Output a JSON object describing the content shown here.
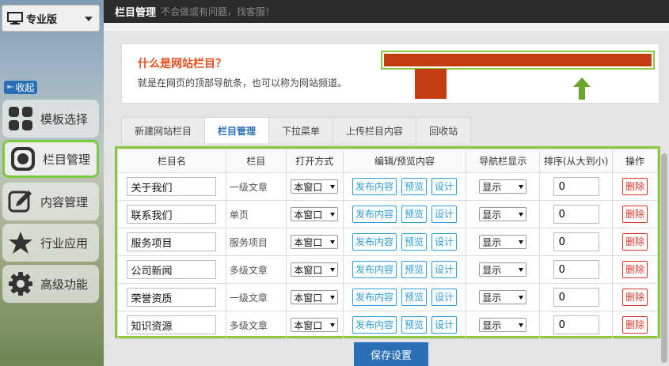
{
  "sidebar": {
    "edition": "专业版",
    "collapse": "收起",
    "items": [
      {
        "label": "模板选择",
        "icon": "grid-icon"
      },
      {
        "label": "栏目管理",
        "icon": "record-icon"
      },
      {
        "label": "内容管理",
        "icon": "pencil-icon"
      },
      {
        "label": "行业应用",
        "icon": "star-icon"
      },
      {
        "label": "高级功能",
        "icon": "gear-icon"
      }
    ],
    "active_index": 1
  },
  "topbar": {
    "title": "栏目管理",
    "subtitle": "不会做或有问题，找客服！"
  },
  "info": {
    "question": "什么是网站栏目？",
    "answer": "就是在网页的顶部导航条，也可以称为网站频道。"
  },
  "tabs": [
    {
      "label": "新建网站栏目"
    },
    {
      "label": "栏目管理"
    },
    {
      "label": "下拉菜单"
    },
    {
      "label": "上传栏目内容"
    },
    {
      "label": "回收站"
    }
  ],
  "active_tab": 1,
  "table": {
    "headers": [
      "栏目名",
      "栏目",
      "打开方式",
      "编辑/预览内容",
      "导航栏显示",
      "排序(从大到小)",
      "操作"
    ],
    "publish_label": "发布内容",
    "preview_label": "预览",
    "design_label": "设计",
    "delete_label": "删除",
    "rows": [
      {
        "name": "关于我们",
        "type": "一级文章",
        "open": "本窗口",
        "show": "显示",
        "order": "0"
      },
      {
        "name": "联系我们",
        "type": "单页",
        "open": "本窗口",
        "show": "显示",
        "order": "0"
      },
      {
        "name": "服务项目",
        "type": "服务项目",
        "open": "本窗口",
        "show": "显示",
        "order": "0"
      },
      {
        "name": "公司新闻",
        "type": "多级文章",
        "open": "本窗口",
        "show": "显示",
        "order": "0"
      },
      {
        "name": "荣誉资质",
        "type": "一级文章",
        "open": "本窗口",
        "show": "显示",
        "order": "0"
      },
      {
        "name": "知识资源",
        "type": "多级文章",
        "open": "本窗口",
        "show": "显示",
        "order": "0"
      }
    ]
  },
  "save_label": "保存设置",
  "colors": {
    "accent": "#2a6fb5",
    "highlight": "#8cc63f",
    "danger": "#d9342b",
    "orange": "#e8501d"
  }
}
